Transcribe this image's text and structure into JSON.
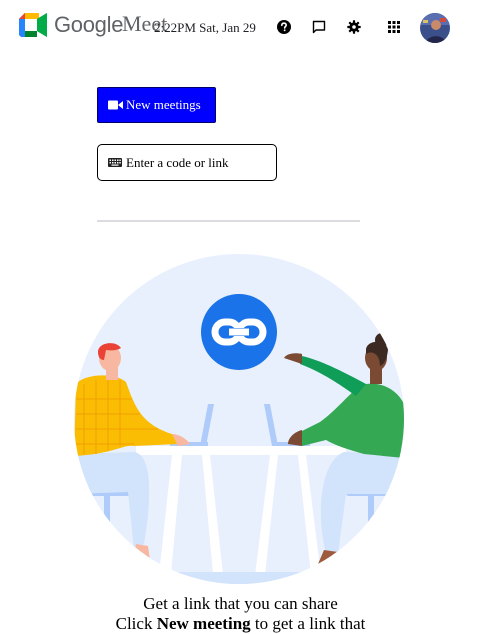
{
  "header": {
    "brand_google": "Google",
    "brand_meet": "Meet",
    "datetime": "2:22PM Sat, Jan 29",
    "icons": [
      "help-icon",
      "feedback-icon",
      "settings-icon",
      "apps-grid-icon"
    ]
  },
  "actions": {
    "new_meeting_label": "New meetings",
    "code_placeholder": "Enter a code or link"
  },
  "caption": {
    "title": "Get a link that you can share",
    "sub_prefix": "Click ",
    "sub_bold": "New meeting",
    "sub_suffix": " to get a link that"
  },
  "colors": {
    "new_meeting_bg": "#0000ff",
    "illustration_bg": "#e8f0fe",
    "link_badge": "#1a73e8"
  }
}
